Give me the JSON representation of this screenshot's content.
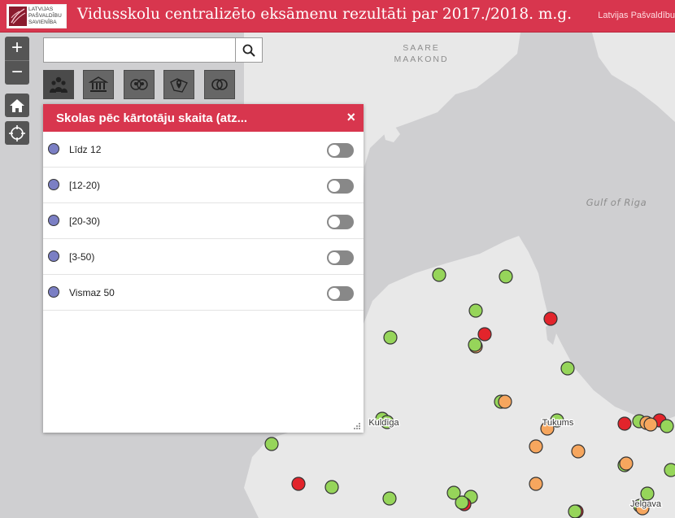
{
  "header": {
    "logo_lines": [
      "LATVIJAS",
      "PAŠVALDĪBU",
      "SAVIENĪBA"
    ],
    "title": "Vidusskolu centralizēto eksāmenu rezultāti par 2017./2018. m.g.",
    "org_link": "Latvijas Pašvaldību"
  },
  "map_controls": {
    "zoom_in": "+",
    "zoom_out": "−"
  },
  "search": {
    "value": "",
    "placeholder": ""
  },
  "toolbar": {
    "tools": [
      {
        "icon": "people-layers-icon",
        "active": true
      },
      {
        "icon": "school-building-icon",
        "active": false
      },
      {
        "icon": "group-layers-icon",
        "active": false
      },
      {
        "icon": "map-pin-icon",
        "active": false
      },
      {
        "icon": "rings-icon",
        "active": false
      }
    ]
  },
  "panel": {
    "title": "Skolas pēc kārtotāju skaita (atz...",
    "close": "×",
    "layers": [
      {
        "label": "Līdz 12",
        "enabled": false
      },
      {
        "label": "[12-20)",
        "enabled": false
      },
      {
        "label": "[20-30)",
        "enabled": false
      },
      {
        "label": "[3-50)",
        "enabled": false
      },
      {
        "label": "Vismaz 50",
        "enabled": false
      }
    ]
  },
  "map": {
    "place_labels": {
      "saaremaa_line1": "SAARE",
      "saaremaa_line2": "MAAKOND",
      "gulf": "Gulf of Riga",
      "kuldiga": "Kuldīga",
      "tukums": "Tukums",
      "jelgava": "Jelgava"
    },
    "colors": {
      "sea": "#cfcfd1",
      "land": "#e8e8e8",
      "green": "#96d55a",
      "orange": "#f6a65e",
      "red": "#e2242b",
      "accent": "#d8364e"
    }
  }
}
